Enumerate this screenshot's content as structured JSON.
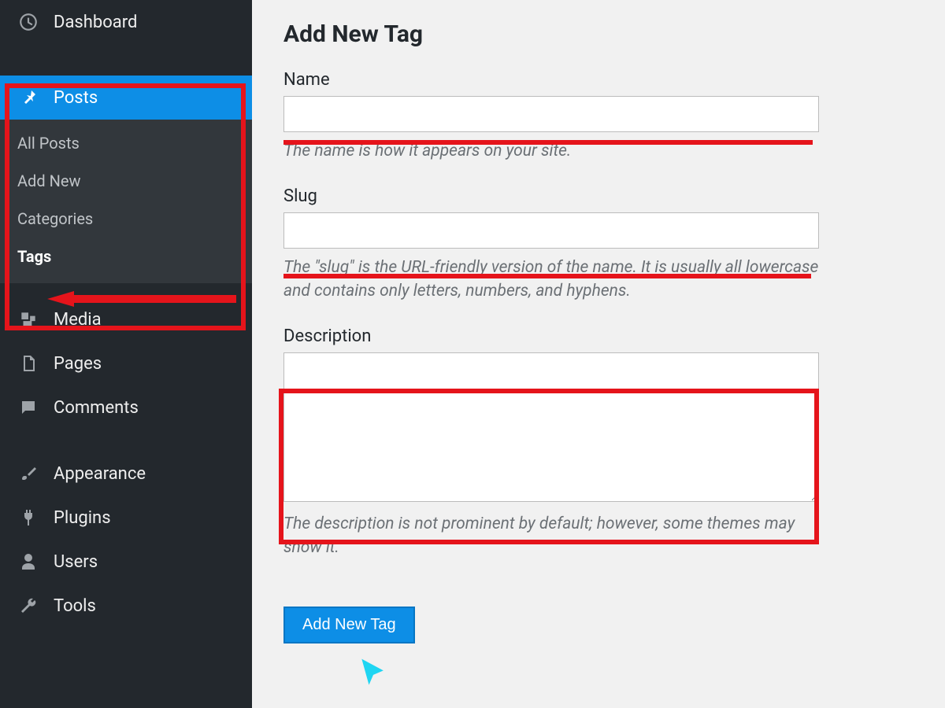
{
  "sidebar": {
    "dashboard": "Dashboard",
    "posts": "Posts",
    "posts_submenu": {
      "all_posts": "All Posts",
      "add_new": "Add New",
      "categories": "Categories",
      "tags": "Tags"
    },
    "media": "Media",
    "pages": "Pages",
    "comments": "Comments",
    "appearance": "Appearance",
    "plugins": "Plugins",
    "users": "Users",
    "tools": "Tools"
  },
  "page": {
    "title": "Add New Tag",
    "name_label": "Name",
    "name_help": "The name is how it appears on your site.",
    "slug_label": "Slug",
    "slug_help": "The \"slug\" is the URL-friendly version of the name. It is usually all lowercase and contains only letters, numbers, and hyphens.",
    "description_label": "Description",
    "description_help": "The description is not prominent by default; however, some themes may show it.",
    "submit_label": "Add New Tag"
  },
  "annotations": {
    "highlight_color": "#e5141b",
    "cursor_color": "#1fd5f2"
  }
}
